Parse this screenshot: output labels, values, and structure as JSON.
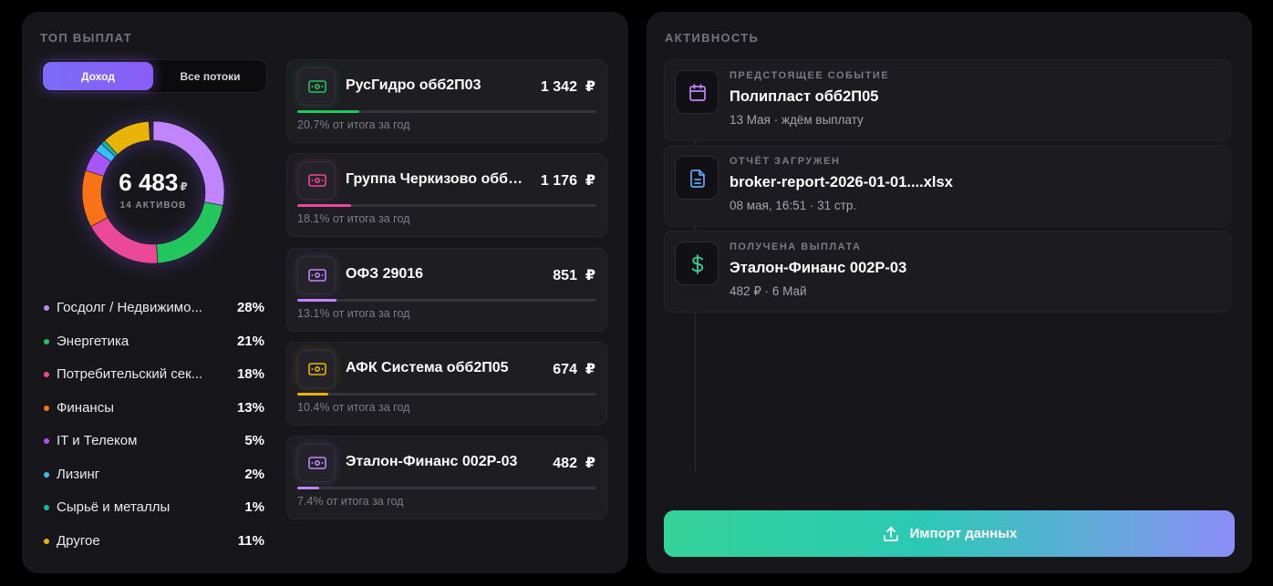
{
  "top_payouts": {
    "title": "ТОП ВЫПЛАТ",
    "toggle": {
      "income_label": "Доход",
      "all_label": "Все потоки",
      "selected": "Доход"
    },
    "total": {
      "value": "6 483",
      "currency": "₽",
      "subtitle": "14 АКТИВОВ"
    },
    "sectors": [
      {
        "name": "Госдолг / Недвижимость",
        "display": "Госдолг / Недвижимо...",
        "pct": "28%",
        "share": 0.28,
        "color": "#c084fc"
      },
      {
        "name": "Энергетика",
        "display": "Энергетика",
        "pct": "21%",
        "share": 0.21,
        "color": "#22c55e"
      },
      {
        "name": "Потребительский сектор",
        "display": "Потребительский сек...",
        "pct": "18%",
        "share": 0.18,
        "color": "#ec4899"
      },
      {
        "name": "Финансы",
        "display": "Финансы",
        "pct": "13%",
        "share": 0.13,
        "color": "#f97316"
      },
      {
        "name": "IT и Телеком",
        "display": "IT и Телеком",
        "pct": "5%",
        "share": 0.05,
        "color": "#a855f7"
      },
      {
        "name": "Лизинг",
        "display": "Лизинг",
        "pct": "2%",
        "share": 0.02,
        "color": "#38bdf8"
      },
      {
        "name": "Сырьё и металлы",
        "display": "Сырьё и металлы",
        "pct": "1%",
        "share": 0.01,
        "color": "#14b8a6"
      },
      {
        "name": "Другое",
        "display": "Другое",
        "pct": "11%",
        "share": 0.11,
        "color": "#eab308"
      }
    ],
    "payouts": [
      {
        "name": "РусГидро обб2П03",
        "amount": "1 342",
        "currency": "₽",
        "share_text": "20.7% от итога за год",
        "share": 0.207,
        "color": "#22c55e",
        "icon": "banknote-icon"
      },
      {
        "name": "Группа Черкизово обб2П05",
        "amount": "1 176",
        "currency": "₽",
        "share_text": "18.1% от итога за год",
        "share": 0.181,
        "color": "#ec4899",
        "icon": "banknote-icon"
      },
      {
        "name": "ОФЗ 29016",
        "amount": "851",
        "currency": "₽",
        "share_text": "13.1% от итога за год",
        "share": 0.131,
        "color": "#c084fc",
        "icon": "banknote-icon"
      },
      {
        "name": "АФК Система обб2П05",
        "amount": "674",
        "currency": "₽",
        "share_text": "10.4% от итога за год",
        "share": 0.104,
        "color": "#eab308",
        "icon": "banknote-icon"
      },
      {
        "name": "Эталон-Финанс 002Р-03",
        "amount": "482",
        "currency": "₽",
        "share_text": "7.4% от итога за год",
        "share": 0.074,
        "color": "#c084fc",
        "icon": "banknote-icon"
      }
    ]
  },
  "activity": {
    "title": "АКТИВНОСТЬ",
    "events": [
      {
        "kind": "ПРЕДСТОЯЩЕЕ СОБЫТИЕ",
        "title": "Полипласт обб2П05",
        "meta": "13 Мая · ждём выплату",
        "icon": "calendar-icon",
        "color": "#c084fc"
      },
      {
        "kind": "ОТЧЁТ ЗАГРУЖЕН",
        "title": "broker-report-2026-01-01....xlsx",
        "meta": "08 мая, 16:51 · 31 стр.",
        "icon": "document-icon",
        "color": "#60a5fa"
      },
      {
        "kind": "ПОЛУЧЕНА ВЫПЛАТА",
        "title": "Эталон-Финанс 002Р-03",
        "meta": "482 ₽ · 6 Май",
        "icon": "dollar-icon",
        "color": "#34d399"
      }
    ],
    "import_label": "Импорт данных"
  }
}
